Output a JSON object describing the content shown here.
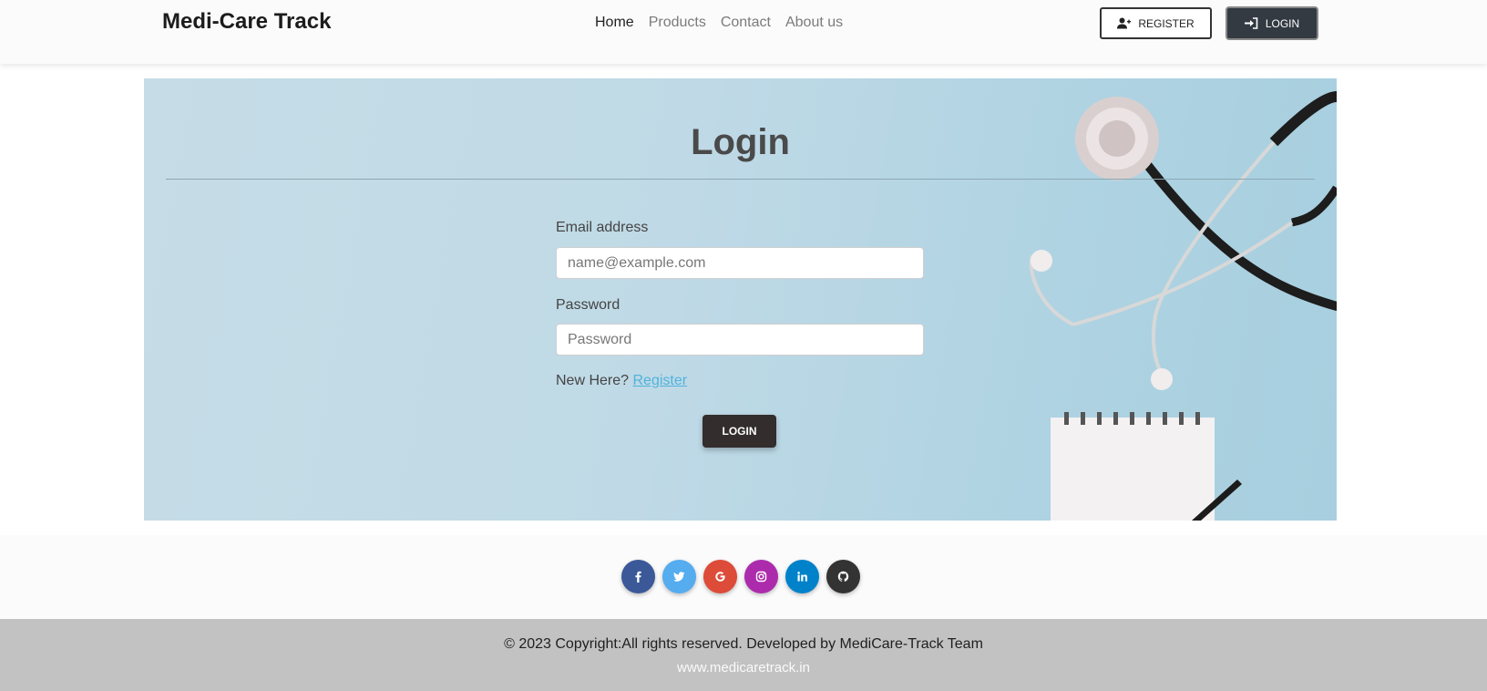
{
  "navbar": {
    "brand": "Medi-Care Track",
    "links": [
      {
        "label": "Home",
        "active": true
      },
      {
        "label": "Products",
        "active": false
      },
      {
        "label": "Contact",
        "active": false
      },
      {
        "label": "About us",
        "active": false
      }
    ],
    "register_label": "REGISTER",
    "login_label": "LOGIN"
  },
  "form": {
    "title": "Login",
    "email_label": "Email address",
    "email_placeholder": "name@example.com",
    "password_label": "Password",
    "password_placeholder": "Password",
    "new_here_text": "New Here?",
    "register_link": "Register",
    "submit_label": "LOGIN"
  },
  "footer": {
    "social": [
      {
        "name": "facebook",
        "glyph": "f",
        "color": "#3b5998"
      },
      {
        "name": "twitter",
        "glyph": "t",
        "color": "#55acee"
      },
      {
        "name": "google",
        "glyph": "G",
        "color": "#dd4b39"
      },
      {
        "name": "instagram",
        "glyph": "ig",
        "color": "#ac2bac"
      },
      {
        "name": "linkedin",
        "glyph": "in",
        "color": "#0082ca"
      },
      {
        "name": "github",
        "glyph": "gh",
        "color": "#333333"
      }
    ],
    "copyright": "© 2023 Copyright:All rights reserved. Developed by MediCare-Track Team",
    "website": "www.medicaretrack.in"
  },
  "colors": {
    "accent_dark": "#332d2d",
    "link": "#4fb3dc",
    "hero_bg": "#b7d7e5",
    "footer_bg": "#c2c2c2"
  }
}
